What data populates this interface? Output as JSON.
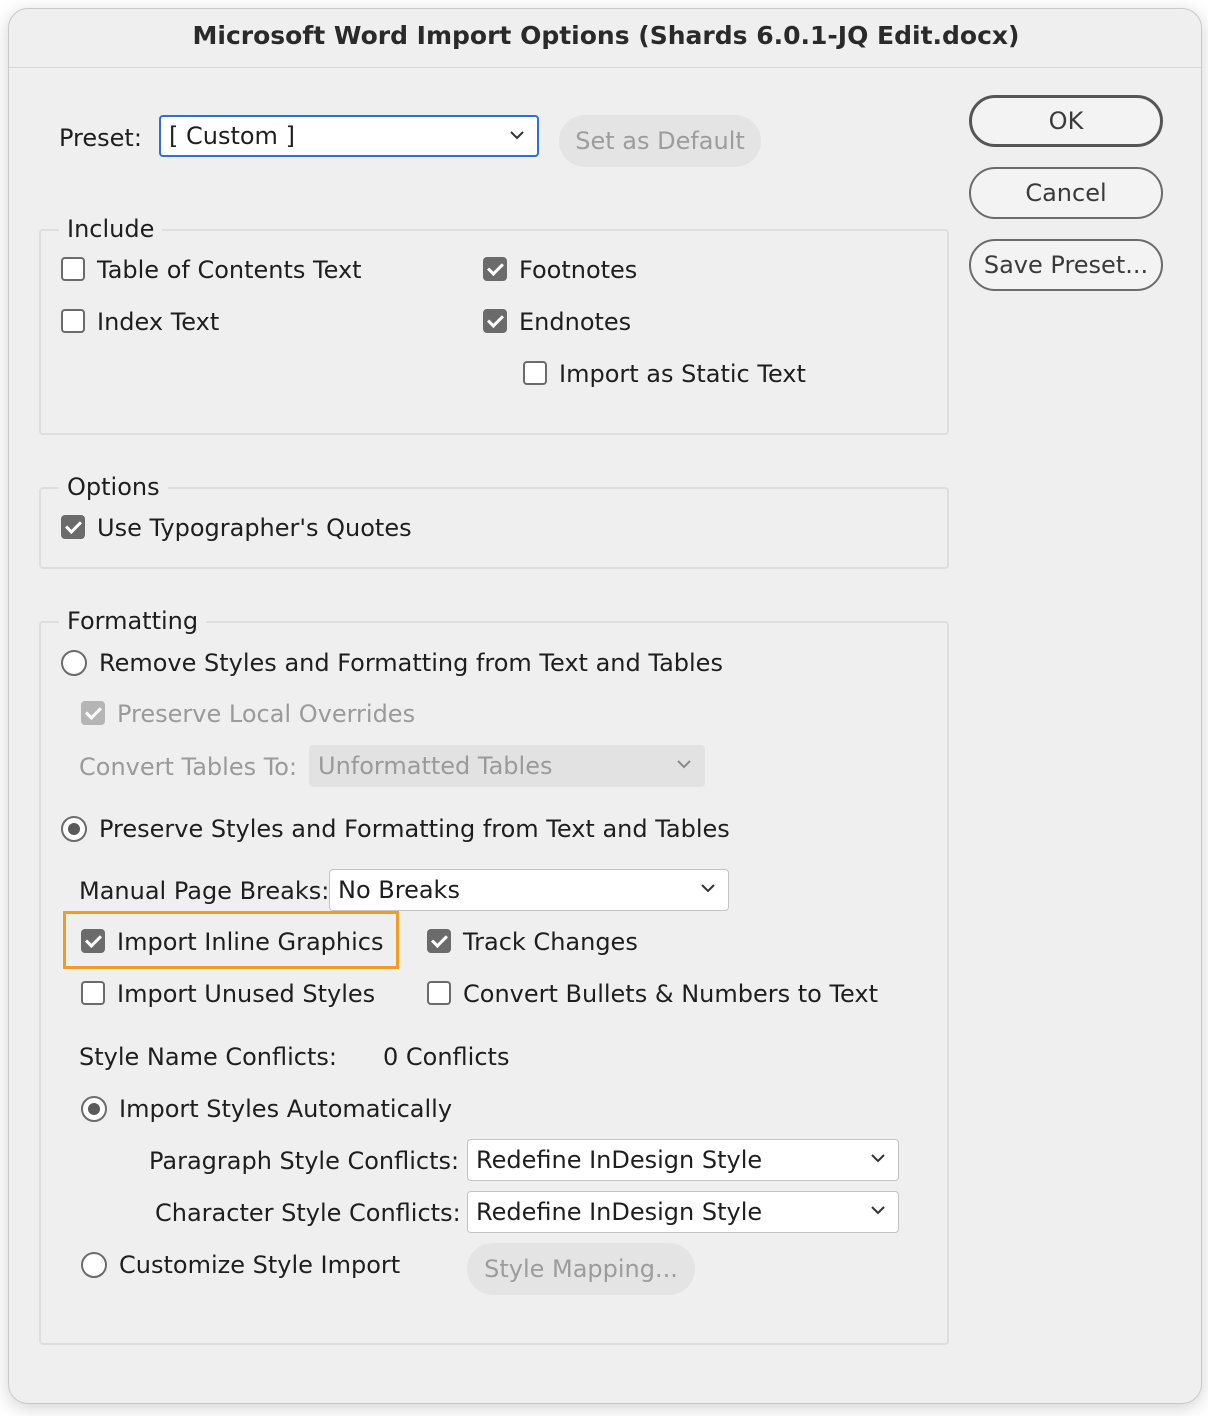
{
  "window": {
    "title": "Microsoft Word Import Options (Shards 6.0.1-JQ Edit.docx)"
  },
  "preset": {
    "label": "Preset:",
    "value": "[ Custom ]",
    "set_default_label": "Set as Default"
  },
  "buttons": {
    "ok": "OK",
    "cancel": "Cancel",
    "save_preset": "Save Preset..."
  },
  "include": {
    "legend": "Include",
    "toc_text": {
      "label": "Table of Contents Text",
      "checked": false
    },
    "index_text": {
      "label": "Index Text",
      "checked": false
    },
    "footnotes": {
      "label": "Footnotes",
      "checked": true
    },
    "endnotes": {
      "label": "Endnotes",
      "checked": true
    },
    "static_text": {
      "label": "Import as Static Text",
      "checked": false
    }
  },
  "options": {
    "legend": "Options",
    "typographers_quotes": {
      "label": "Use Typographer's Quotes",
      "checked": true
    }
  },
  "formatting": {
    "legend": "Formatting",
    "remove_styles": {
      "label": "Remove Styles and Formatting from Text and Tables",
      "selected": false
    },
    "preserve_overrides": {
      "label": "Preserve Local Overrides",
      "checked": true,
      "disabled": true
    },
    "convert_tables": {
      "label": "Convert Tables To:",
      "value": "Unformatted Tables",
      "disabled": true
    },
    "preserve_styles": {
      "label": "Preserve Styles and Formatting from Text and Tables",
      "selected": true
    },
    "page_breaks": {
      "label": "Manual Page Breaks:",
      "value": "No Breaks"
    },
    "inline_graphics": {
      "label": "Import Inline Graphics",
      "checked": true,
      "highlighted": true
    },
    "track_changes": {
      "label": "Track Changes",
      "checked": true
    },
    "unused_styles": {
      "label": "Import Unused Styles",
      "checked": false
    },
    "convert_bullets": {
      "label": "Convert Bullets & Numbers to Text",
      "checked": false
    },
    "style_conflicts": {
      "label": "Style Name Conflicts:",
      "value": "0 Conflicts"
    },
    "import_auto": {
      "label": "Import Styles Automatically",
      "selected": true
    },
    "paragraph_conflicts": {
      "label": "Paragraph Style Conflicts:",
      "value": "Redefine InDesign Style"
    },
    "character_conflicts": {
      "label": "Character Style Conflicts:",
      "value": "Redefine InDesign Style"
    },
    "customize_import": {
      "label": "Customize Style Import",
      "selected": false
    },
    "style_mapping_label": "Style Mapping..."
  },
  "colors": {
    "highlight": "#f39c25",
    "focus_ring": "#2f6fd6"
  }
}
